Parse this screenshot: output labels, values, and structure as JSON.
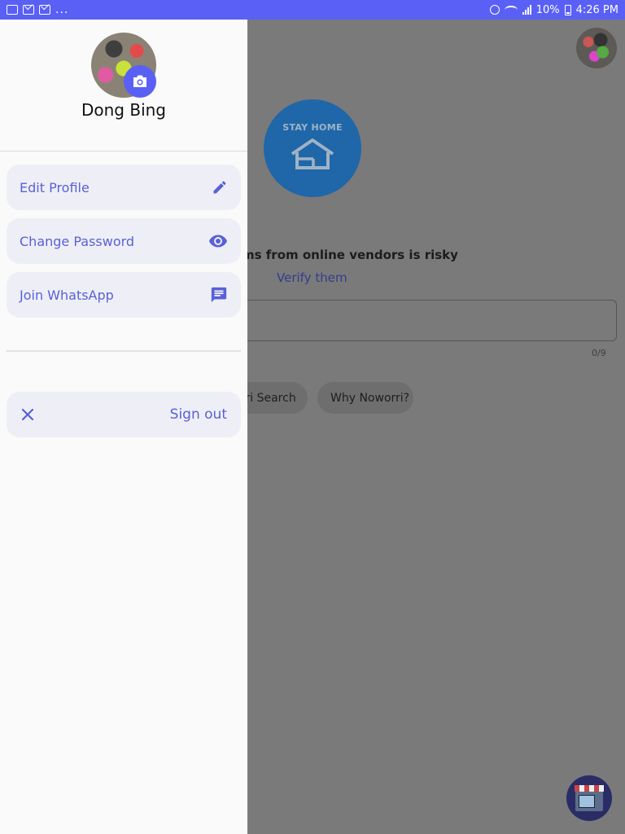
{
  "status_bar": {
    "overflow": "...",
    "battery": "10%",
    "time": "4:26 PM",
    "icons": [
      "calendar-icon",
      "mail-icon",
      "mail-icon",
      "alarm-icon",
      "wifi-icon",
      "signal-icon",
      "battery-icon"
    ]
  },
  "drawer": {
    "name": "Dong Bing",
    "items": [
      {
        "label": "Edit Profile",
        "icon": "pencil-icon"
      },
      {
        "label": "Change Password",
        "icon": "eye-icon"
      },
      {
        "label": "Join WhatsApp",
        "icon": "message-icon"
      }
    ],
    "signout": {
      "label": "Sign out",
      "icon": "close-icon"
    }
  },
  "main": {
    "banner_text": "STAY HOME",
    "risk_text": "ms from online vendors is risky",
    "verify_link": "Verify them",
    "counter": "0/9",
    "chips": [
      "rri Search",
      "Why Noworri?"
    ]
  },
  "colors": {
    "accent": "#5a60f5",
    "menu_text": "#5a60d6",
    "menu_bg": "#eeeff6",
    "scrim": "#7a7a7a"
  }
}
